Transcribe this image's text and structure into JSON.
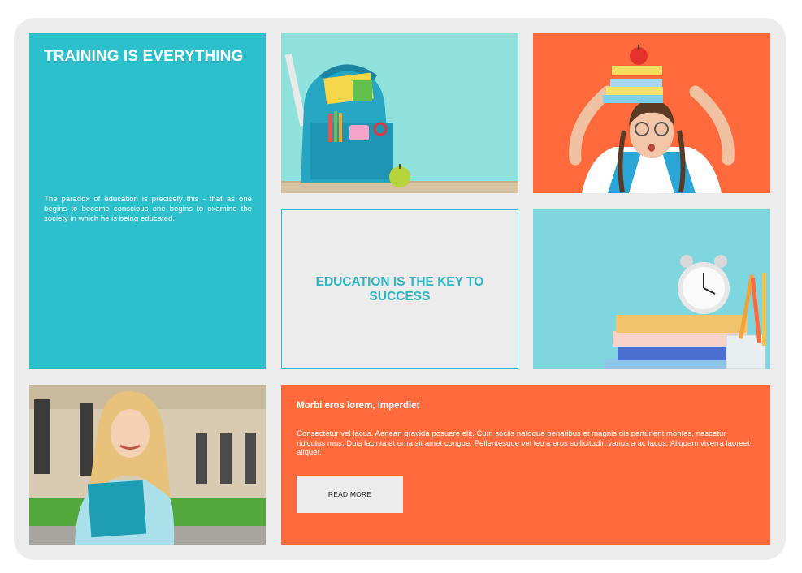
{
  "hero": {
    "title": "TRAINING IS EVERYTHING",
    "body": "The paradox of education is precisely this - that as one begins to become conscious one begins to examine the society in which he is being educated."
  },
  "education_tile": {
    "title": "EDUCATION IS THE KEY TO SUCCESS"
  },
  "promo": {
    "heading": "Morbi eros lorem, imperdiet",
    "body": "Consectetur vel lacus. Aenean gravida posuere elit. Cum sociis natoque penatibus et magnis dis parturient montes, nascetur ridiculus mus. Duis lacinia et urna sit amet congue. Pellentesque vel leo a eros sollicitudin varius a ac lacus. Aliquam viverra laoreet aliquet.",
    "button_label": "READ MORE"
  },
  "colors": {
    "teal": "#2bc0cc",
    "orange": "#ff6a3d",
    "panel_gray": "#ececec"
  }
}
